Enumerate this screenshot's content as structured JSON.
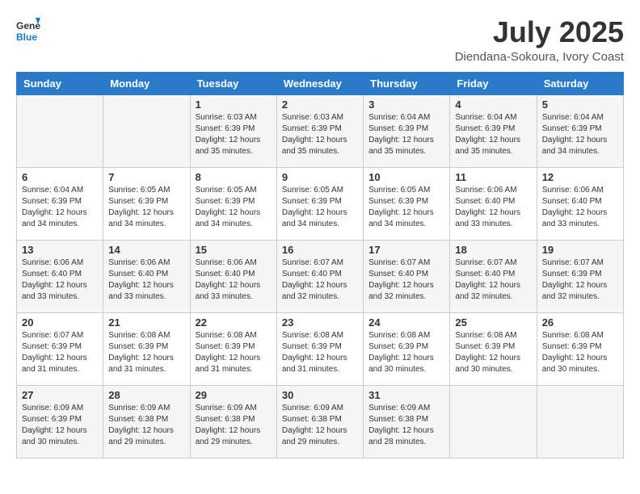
{
  "logo": {
    "text_general": "General",
    "text_blue": "Blue"
  },
  "header": {
    "month": "July 2025",
    "location": "Diendana-Sokoura, Ivory Coast"
  },
  "days_of_week": [
    "Sunday",
    "Monday",
    "Tuesday",
    "Wednesday",
    "Thursday",
    "Friday",
    "Saturday"
  ],
  "weeks": [
    [
      {
        "day": "",
        "sunrise": "",
        "sunset": "",
        "daylight": ""
      },
      {
        "day": "",
        "sunrise": "",
        "sunset": "",
        "daylight": ""
      },
      {
        "day": "1",
        "sunrise": "Sunrise: 6:03 AM",
        "sunset": "Sunset: 6:39 PM",
        "daylight": "Daylight: 12 hours and 35 minutes."
      },
      {
        "day": "2",
        "sunrise": "Sunrise: 6:03 AM",
        "sunset": "Sunset: 6:39 PM",
        "daylight": "Daylight: 12 hours and 35 minutes."
      },
      {
        "day": "3",
        "sunrise": "Sunrise: 6:04 AM",
        "sunset": "Sunset: 6:39 PM",
        "daylight": "Daylight: 12 hours and 35 minutes."
      },
      {
        "day": "4",
        "sunrise": "Sunrise: 6:04 AM",
        "sunset": "Sunset: 6:39 PM",
        "daylight": "Daylight: 12 hours and 35 minutes."
      },
      {
        "day": "5",
        "sunrise": "Sunrise: 6:04 AM",
        "sunset": "Sunset: 6:39 PM",
        "daylight": "Daylight: 12 hours and 34 minutes."
      }
    ],
    [
      {
        "day": "6",
        "sunrise": "Sunrise: 6:04 AM",
        "sunset": "Sunset: 6:39 PM",
        "daylight": "Daylight: 12 hours and 34 minutes."
      },
      {
        "day": "7",
        "sunrise": "Sunrise: 6:05 AM",
        "sunset": "Sunset: 6:39 PM",
        "daylight": "Daylight: 12 hours and 34 minutes."
      },
      {
        "day": "8",
        "sunrise": "Sunrise: 6:05 AM",
        "sunset": "Sunset: 6:39 PM",
        "daylight": "Daylight: 12 hours and 34 minutes."
      },
      {
        "day": "9",
        "sunrise": "Sunrise: 6:05 AM",
        "sunset": "Sunset: 6:39 PM",
        "daylight": "Daylight: 12 hours and 34 minutes."
      },
      {
        "day": "10",
        "sunrise": "Sunrise: 6:05 AM",
        "sunset": "Sunset: 6:39 PM",
        "daylight": "Daylight: 12 hours and 34 minutes."
      },
      {
        "day": "11",
        "sunrise": "Sunrise: 6:06 AM",
        "sunset": "Sunset: 6:40 PM",
        "daylight": "Daylight: 12 hours and 33 minutes."
      },
      {
        "day": "12",
        "sunrise": "Sunrise: 6:06 AM",
        "sunset": "Sunset: 6:40 PM",
        "daylight": "Daylight: 12 hours and 33 minutes."
      }
    ],
    [
      {
        "day": "13",
        "sunrise": "Sunrise: 6:06 AM",
        "sunset": "Sunset: 6:40 PM",
        "daylight": "Daylight: 12 hours and 33 minutes."
      },
      {
        "day": "14",
        "sunrise": "Sunrise: 6:06 AM",
        "sunset": "Sunset: 6:40 PM",
        "daylight": "Daylight: 12 hours and 33 minutes."
      },
      {
        "day": "15",
        "sunrise": "Sunrise: 6:06 AM",
        "sunset": "Sunset: 6:40 PM",
        "daylight": "Daylight: 12 hours and 33 minutes."
      },
      {
        "day": "16",
        "sunrise": "Sunrise: 6:07 AM",
        "sunset": "Sunset: 6:40 PM",
        "daylight": "Daylight: 12 hours and 32 minutes."
      },
      {
        "day": "17",
        "sunrise": "Sunrise: 6:07 AM",
        "sunset": "Sunset: 6:40 PM",
        "daylight": "Daylight: 12 hours and 32 minutes."
      },
      {
        "day": "18",
        "sunrise": "Sunrise: 6:07 AM",
        "sunset": "Sunset: 6:40 PM",
        "daylight": "Daylight: 12 hours and 32 minutes."
      },
      {
        "day": "19",
        "sunrise": "Sunrise: 6:07 AM",
        "sunset": "Sunset: 6:39 PM",
        "daylight": "Daylight: 12 hours and 32 minutes."
      }
    ],
    [
      {
        "day": "20",
        "sunrise": "Sunrise: 6:07 AM",
        "sunset": "Sunset: 6:39 PM",
        "daylight": "Daylight: 12 hours and 31 minutes."
      },
      {
        "day": "21",
        "sunrise": "Sunrise: 6:08 AM",
        "sunset": "Sunset: 6:39 PM",
        "daylight": "Daylight: 12 hours and 31 minutes."
      },
      {
        "day": "22",
        "sunrise": "Sunrise: 6:08 AM",
        "sunset": "Sunset: 6:39 PM",
        "daylight": "Daylight: 12 hours and 31 minutes."
      },
      {
        "day": "23",
        "sunrise": "Sunrise: 6:08 AM",
        "sunset": "Sunset: 6:39 PM",
        "daylight": "Daylight: 12 hours and 31 minutes."
      },
      {
        "day": "24",
        "sunrise": "Sunrise: 6:08 AM",
        "sunset": "Sunset: 6:39 PM",
        "daylight": "Daylight: 12 hours and 30 minutes."
      },
      {
        "day": "25",
        "sunrise": "Sunrise: 6:08 AM",
        "sunset": "Sunset: 6:39 PM",
        "daylight": "Daylight: 12 hours and 30 minutes."
      },
      {
        "day": "26",
        "sunrise": "Sunrise: 6:08 AM",
        "sunset": "Sunset: 6:39 PM",
        "daylight": "Daylight: 12 hours and 30 minutes."
      }
    ],
    [
      {
        "day": "27",
        "sunrise": "Sunrise: 6:09 AM",
        "sunset": "Sunset: 6:39 PM",
        "daylight": "Daylight: 12 hours and 30 minutes."
      },
      {
        "day": "28",
        "sunrise": "Sunrise: 6:09 AM",
        "sunset": "Sunset: 6:38 PM",
        "daylight": "Daylight: 12 hours and 29 minutes."
      },
      {
        "day": "29",
        "sunrise": "Sunrise: 6:09 AM",
        "sunset": "Sunset: 6:38 PM",
        "daylight": "Daylight: 12 hours and 29 minutes."
      },
      {
        "day": "30",
        "sunrise": "Sunrise: 6:09 AM",
        "sunset": "Sunset: 6:38 PM",
        "daylight": "Daylight: 12 hours and 29 minutes."
      },
      {
        "day": "31",
        "sunrise": "Sunrise: 6:09 AM",
        "sunset": "Sunset: 6:38 PM",
        "daylight": "Daylight: 12 hours and 28 minutes."
      },
      {
        "day": "",
        "sunrise": "",
        "sunset": "",
        "daylight": ""
      },
      {
        "day": "",
        "sunrise": "",
        "sunset": "",
        "daylight": ""
      }
    ]
  ]
}
